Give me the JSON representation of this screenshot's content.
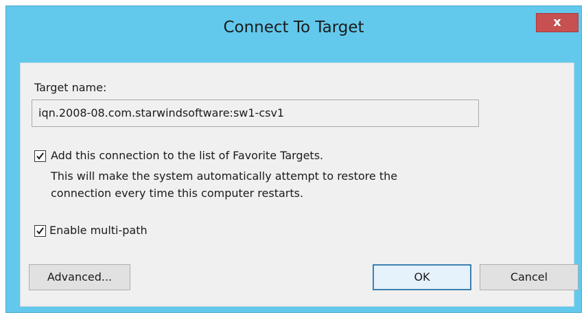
{
  "window": {
    "title": "Connect To Target",
    "close_label": "x"
  },
  "target": {
    "label": "Target name:",
    "value": "iqn.2008-08.com.starwindsoftware:sw1-csv1"
  },
  "favorite": {
    "checked": true,
    "label": "Add this connection to the list of Favorite Targets.",
    "description_line1": "This will make the system automatically attempt to restore the",
    "description_line2": "connection every time this computer restarts."
  },
  "multipath": {
    "checked": true,
    "label": "Enable multi-path"
  },
  "buttons": {
    "advanced": "Advanced...",
    "ok": "OK",
    "cancel": "Cancel"
  },
  "colors": {
    "titlebar": "#62c9ec",
    "close": "#c75050",
    "client": "#f0f0f0"
  }
}
